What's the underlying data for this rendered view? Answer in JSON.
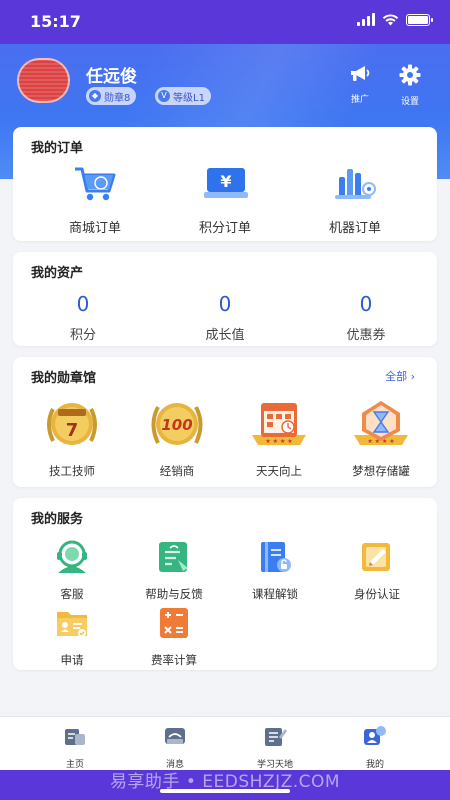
{
  "status": {
    "time": "15:17"
  },
  "header": {
    "user_name": "任远俊",
    "badge_medal": "勋章8",
    "badge_level": "等级L1",
    "promote_label": "推广",
    "settings_label": "设置"
  },
  "orders": {
    "title": "我的订单",
    "items": [
      {
        "label": "商城订单",
        "icon": "shopping-cart-icon"
      },
      {
        "label": "积分订单",
        "icon": "yen-card-icon"
      },
      {
        "label": "机器订单",
        "icon": "machine-icon"
      }
    ]
  },
  "assets": {
    "title": "我的资产",
    "items": [
      {
        "value": "0",
        "label": "积分"
      },
      {
        "value": "0",
        "label": "成长值"
      },
      {
        "value": "0",
        "label": "优惠券"
      }
    ]
  },
  "medals": {
    "title": "我的勋章馆",
    "more": "全部",
    "items": [
      {
        "label": "技工技师",
        "icon": "gold-medal-7-icon",
        "badge_text": "7"
      },
      {
        "label": "经销商",
        "icon": "gold-medal-100-icon",
        "badge_text": "100"
      },
      {
        "label": "天天向上",
        "icon": "calendar-medal-icon"
      },
      {
        "label": "梦想存储罐",
        "icon": "hourglass-medal-icon"
      }
    ]
  },
  "services": {
    "title": "我的服务",
    "items": [
      {
        "label": "客服",
        "icon": "customer-service-icon"
      },
      {
        "label": "帮助与反馈",
        "icon": "help-feedback-icon"
      },
      {
        "label": "课程解锁",
        "icon": "course-unlock-icon"
      },
      {
        "label": "身份认证",
        "icon": "identity-verify-icon"
      },
      {
        "label": "申请",
        "icon": "application-folder-icon"
      },
      {
        "label": "费率计算",
        "icon": "rate-calculator-icon"
      }
    ]
  },
  "tabbar": {
    "items": [
      {
        "label": "主页",
        "icon": "home-icon"
      },
      {
        "label": "消息",
        "icon": "message-icon"
      },
      {
        "label": "学习天地",
        "icon": "study-icon"
      },
      {
        "label": "我的",
        "icon": "profile-icon",
        "active": true
      }
    ]
  },
  "watermark": "易享助手 • EEDSHZJZ.COM",
  "colors": {
    "status_bar": "#5a37d8",
    "header": "#3f76f2",
    "accent": "#2d5bd0",
    "page_bg": "#f3f4f8"
  }
}
